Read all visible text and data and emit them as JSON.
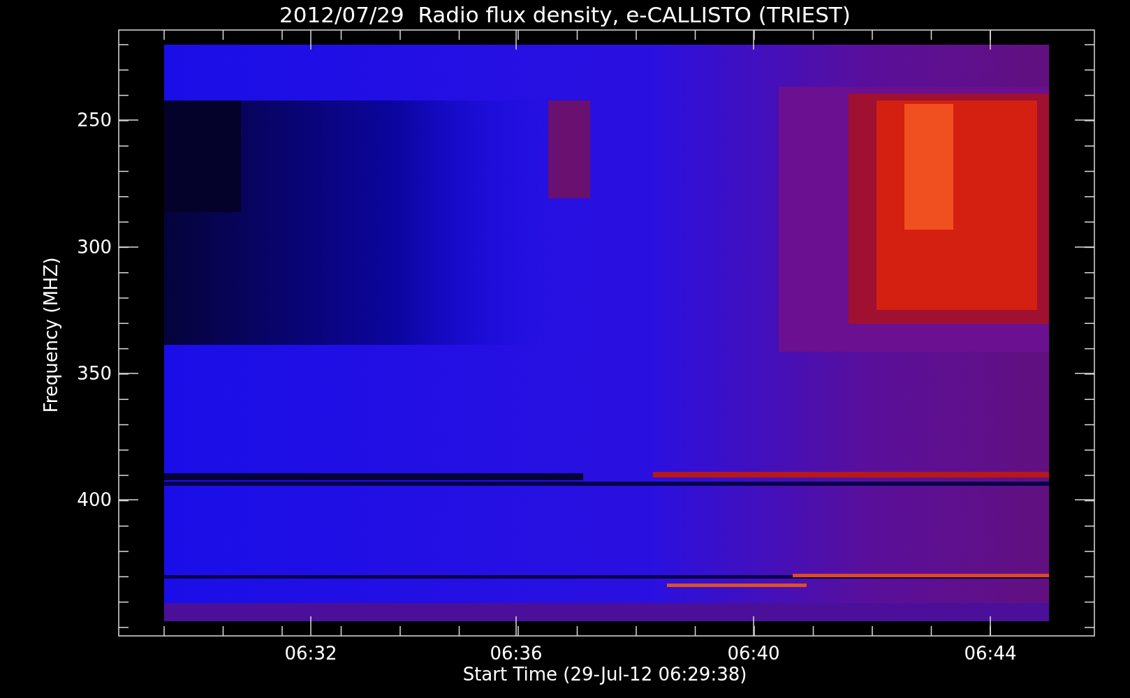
{
  "title": "2012/07/29  Radio flux density, e-CALLISTO (TRIEST)",
  "y_axis": {
    "label": "Frequency (MHZ)",
    "ticks": [
      "250",
      "300",
      "350",
      "400"
    ]
  },
  "x_axis": {
    "label": "Start Time (29-Jul-12 06:29:38)",
    "ticks": [
      "06:32",
      "06:36",
      "06:40",
      "06:44"
    ]
  }
}
